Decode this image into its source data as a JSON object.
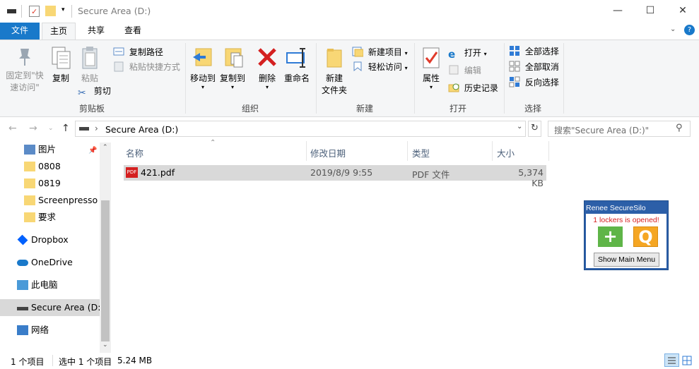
{
  "window": {
    "title": "Secure Area (D:)"
  },
  "tabs": {
    "file": "文件",
    "home": "主页",
    "share": "共享",
    "view": "查看"
  },
  "ribbon": {
    "clipboard": {
      "label": "剪贴板",
      "pin_quick": "固定到\"快\n速访问\"",
      "copy": "复制",
      "paste": "粘贴",
      "copy_path": "复制路径",
      "paste_shortcut": "粘贴快捷方式",
      "cut": "剪切"
    },
    "organize": {
      "label": "组织",
      "move_to": "移动到",
      "copy_to": "复制到",
      "delete": "删除",
      "rename": "重命名"
    },
    "new": {
      "label": "新建",
      "new_folder": "新建\n文件夹",
      "new_item": "新建项目",
      "easy_access": "轻松访问"
    },
    "open": {
      "label": "打开",
      "properties": "属性",
      "open": "打开",
      "edit": "编辑",
      "history": "历史记录"
    },
    "select": {
      "label": "选择",
      "select_all": "全部选择",
      "select_none": "全部取消",
      "invert": "反向选择"
    }
  },
  "address": {
    "path": "Secure Area (D:)",
    "search_placeholder": "搜索\"Secure Area (D:)\""
  },
  "nav": {
    "items": [
      {
        "label": "图片",
        "icon": "pictures-icon"
      },
      {
        "label": "0808",
        "icon": "folder-icon"
      },
      {
        "label": "0819",
        "icon": "folder-icon"
      },
      {
        "label": "Screenpresso",
        "icon": "folder-icon"
      },
      {
        "label": "要求",
        "icon": "folder-icon"
      },
      {
        "label": "Dropbox",
        "icon": "dropbox-icon"
      },
      {
        "label": "OneDrive",
        "icon": "onedrive-icon"
      },
      {
        "label": "此电脑",
        "icon": "pc-icon"
      },
      {
        "label": "Secure Area (D:)",
        "icon": "drive-icon"
      },
      {
        "label": "网络",
        "icon": "network-icon"
      }
    ]
  },
  "columns": {
    "name": "名称",
    "modified": "修改日期",
    "type": "类型",
    "size": "大小"
  },
  "files": [
    {
      "name": "421.pdf",
      "modified": "2019/8/9 9:55",
      "type": "PDF 文件",
      "size": "5,374 KB"
    }
  ],
  "status": {
    "count": "1 个项目",
    "selected": "选中 1 个项目",
    "size": "5.24 MB"
  },
  "silo": {
    "title": "Renee SecureSilo",
    "message": "1 lockers is opened!",
    "add": "+",
    "quick": "Q",
    "main_menu": "Show Main Menu"
  },
  "colors": {
    "accent": "#1979ca",
    "silo_blue": "#2c5fa8",
    "green": "#5fb548",
    "orange": "#f5a623"
  }
}
